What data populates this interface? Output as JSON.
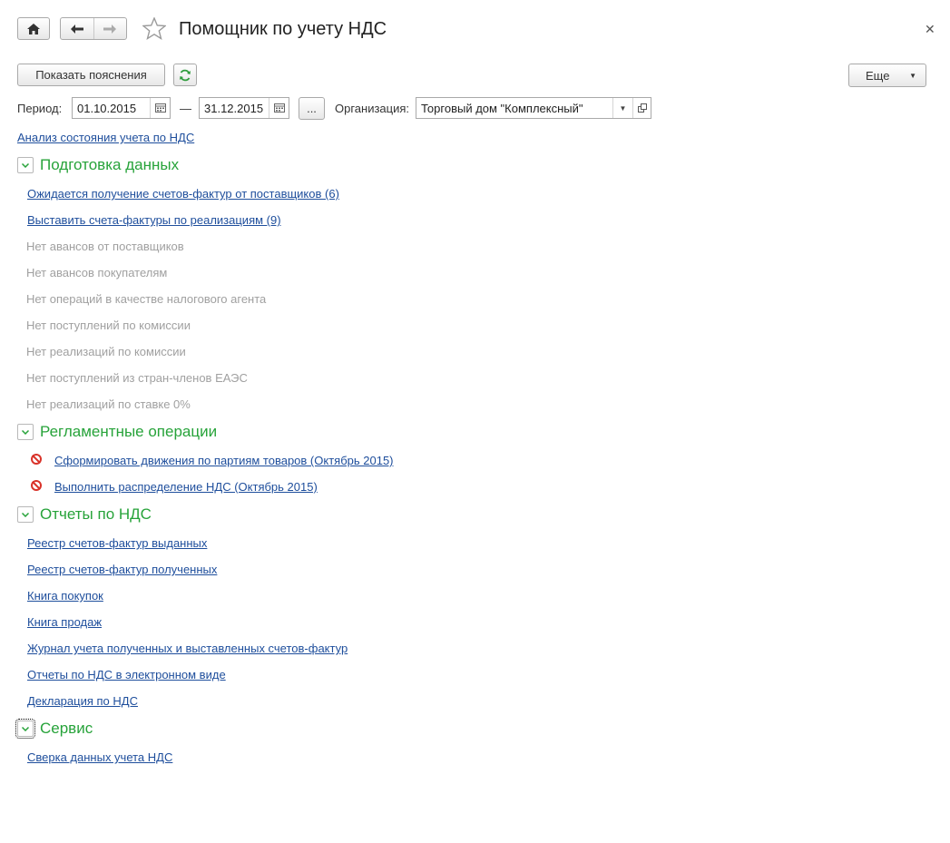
{
  "window": {
    "title": "Помощник по учету НДС"
  },
  "toolbar": {
    "explain_label": "Показать пояснения",
    "more_label": "Еще"
  },
  "period": {
    "label": "Период:",
    "from": "01.10.2015",
    "dash": "—",
    "to": "31.12.2015",
    "ellipsis": "..."
  },
  "organization": {
    "label": "Организация:",
    "value": "Торговый дом \"Комплексный\""
  },
  "analysis_link": "Анализ состояния учета по НДС",
  "sections": [
    {
      "title": "Подготовка данных",
      "links": [
        "Ожидается получение счетов-фактур от поставщиков (6)",
        "Выставить счета-фактуры по реализациям (9)"
      ],
      "muted": [
        "Нет авансов от поставщиков",
        "Нет авансов покупателям",
        "Нет операций в качестве налогового агента",
        "Нет поступлений по комиссии",
        "Нет реализаций по комиссии",
        "Нет поступлений из стран-членов ЕАЭС",
        "Нет реализаций по ставке 0%"
      ]
    },
    {
      "title": "Регламентные операции",
      "links": [
        "Сформировать движения по партиям товаров (Октябрь 2015)",
        "Выполнить распределение НДС (Октябрь 2015)"
      ]
    },
    {
      "title": "Отчеты по НДС",
      "links": [
        "Реестр счетов-фактур выданных",
        "Реестр счетов-фактур полученных",
        "Книга покупок",
        "Книга продаж",
        "Журнал учета полученных и выставленных счетов-фактур",
        "Отчеты по НДС в электронном виде",
        "Декларация по НДС"
      ]
    },
    {
      "title": "Сервис",
      "links": [
        "Сверка данных учета НДС"
      ]
    }
  ],
  "colors": {
    "accent_green": "#27a33a",
    "link_blue": "#1e4e9c",
    "muted_gray": "#a0a0a0",
    "error_red": "#d9332a"
  }
}
